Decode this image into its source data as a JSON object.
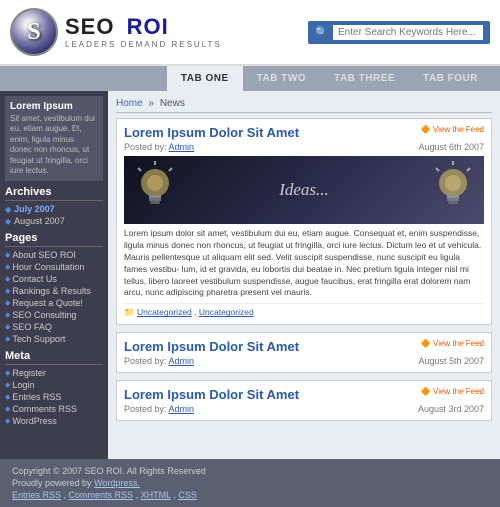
{
  "header": {
    "logo_letter": "S",
    "logo_name_part1": "SEO",
    "logo_name_part2": "ROI",
    "logo_tagline": "Leaders Demand Results",
    "search_placeholder": "Enter Search Keywords Here..."
  },
  "nav": {
    "tabs": [
      {
        "label": "TAB ONE",
        "active": true
      },
      {
        "label": "TAB TWO",
        "active": false
      },
      {
        "label": "Tab Three",
        "active": false
      },
      {
        "label": "TAB FouR",
        "active": false
      }
    ]
  },
  "sidebar": {
    "promo_title": "Lorem Ipsum",
    "promo_text": "Sit amet, vestibulum dui eu, etiam augue. Et, enim, ligula minus donec non rhoncus, ut feugiat ut fringilla, orci iure lectus.",
    "archives_title": "Archives",
    "archives": [
      {
        "label": "July 2007",
        "active": true
      },
      {
        "label": "August 2007",
        "active": false
      }
    ],
    "pages_title": "Pages",
    "pages": [
      "About SEO ROI",
      "Hour Consultation",
      "Contact Us",
      "Rankings & Results",
      "Request a Quote!",
      "SEO Consulting",
      "SEO FAQ",
      "Tech Support"
    ],
    "meta_title": "Meta",
    "meta": [
      "Register",
      "Login",
      "Entries RSS",
      "Comments RSS",
      "WordPress"
    ]
  },
  "breadcrumb": {
    "home": "Home",
    "separator": "»",
    "current": "News"
  },
  "posts": [
    {
      "title": "Lorem Ipsum Dolor Sit Amet",
      "posted_by_label": "Posted by:",
      "author": "Admin",
      "feed_label": "View the Feed",
      "date": "August 6th 2007",
      "has_banner": true,
      "ideas_text": "Ideas...",
      "body": "Lorem ipsum dolor sit amet, vestibulum dui eu, etiam augue. Consequat et, enim suspendisse, ligula minus donec non rhoncus, ut feugiat ut fringilla, orci iure lectus. Dictum leo et ut vehicula. Mauris pellentesque ut aliquam elit sed. Velit suscipit suspendisse, nunc suscipit eu ligula fames vestibu- lum, id et gravida, eu lobortis dui beatae in. Nec pretium ligula integer nisl mi tellus, libero laoreet vestibulum suspendisse, augue faucibus, erat fringilla erat dolorem nam arcu, nunc adipiscing pharetra present vel mauris.",
      "categories": [
        "Uncategorized",
        "Uncategorized"
      ]
    },
    {
      "title": "Lorem Ipsum Dolor Sit Amet",
      "posted_by_label": "Posted by:",
      "author": "Admin",
      "feed_label": "View the Feed",
      "date": "August 5th 2007",
      "has_banner": false,
      "body": "",
      "categories": []
    },
    {
      "title": "Lorem Ipsum Dolor Sit Amet",
      "posted_by_label": "Posted by:",
      "author": "Admin",
      "feed_label": "View the Feed",
      "date": "August 3rd 2007",
      "has_banner": false,
      "body": "",
      "categories": []
    }
  ],
  "footer": {
    "copyright": "Copyright © 2007 SEO ROI.",
    "rights": "All Rights Reserved",
    "powered_label": "Proudly powered by",
    "powered_link": "Wordpress.",
    "links": [
      "Entries RSS",
      "Comments RSS",
      "XHTML",
      "CSS"
    ]
  }
}
